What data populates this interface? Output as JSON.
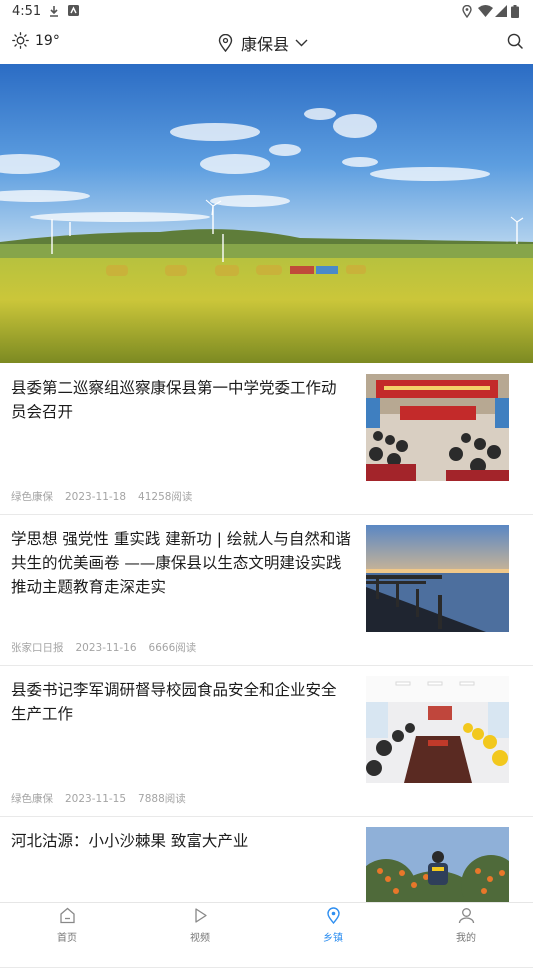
{
  "status_bar": {
    "time": "4:51",
    "left_icons": [
      "download-icon",
      "notification-app-icon"
    ],
    "right_icons": [
      "location-icon",
      "wifi-icon",
      "signal-icon",
      "battery-icon"
    ]
  },
  "header": {
    "weather_icon": "sun-icon",
    "temperature": "19°",
    "location_icon": "location-pin-icon",
    "location": "康保县",
    "dropdown_icon": "chevron-down-icon",
    "search_icon": "search-icon"
  },
  "news": [
    {
      "title": "县委第二巡察组巡察康保县第一中学党委工作动员会召开",
      "source": "绿色康保",
      "date": "2023-11-18",
      "reads": "41258阅读"
    },
    {
      "title": "学思想 强党性 重实践 建新功 | 绘就人与自然和谐共生的优美画卷 ——康保县以生态文明建设实践推动主题教育走深走实",
      "source": "张家口日报",
      "date": "2023-11-16",
      "reads": "6666阅读"
    },
    {
      "title": "县委书记李军调研督导校园食品安全和企业安全生产工作",
      "source": "绿色康保",
      "date": "2023-11-15",
      "reads": "7888阅读"
    },
    {
      "title": "河北沽源：小小沙棘果 致富大产业",
      "source": "",
      "date": "",
      "reads": ""
    }
  ],
  "bottom_nav": [
    {
      "label": "首页",
      "icon": "home-icon"
    },
    {
      "label": "视频",
      "icon": "play-icon"
    },
    {
      "label": "乡镇",
      "icon": "location-pin-icon",
      "active": true
    },
    {
      "label": "我的",
      "icon": "user-icon"
    }
  ],
  "colors": {
    "accent": "#2f8ff0",
    "meta_text": "#a4a4a4",
    "divider": "#e9e9e9"
  }
}
